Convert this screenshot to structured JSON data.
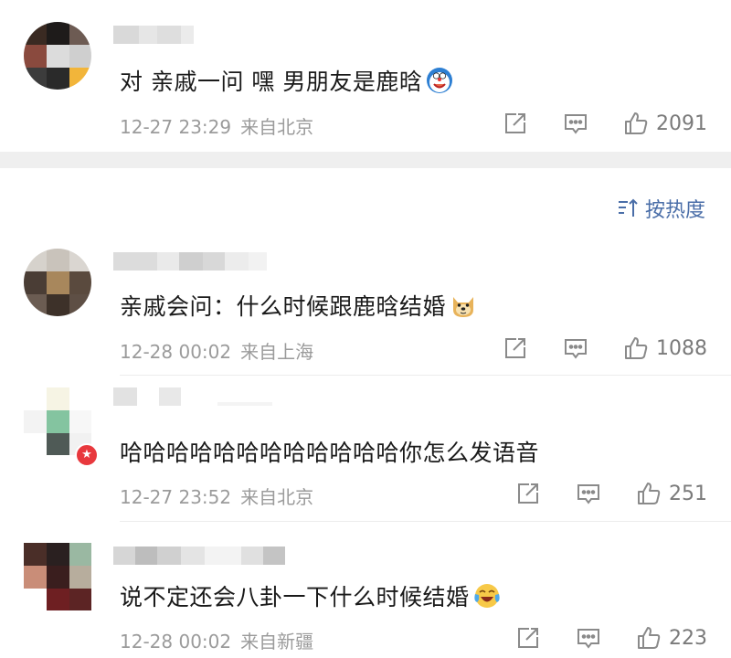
{
  "sort": {
    "label": "按热度",
    "icon": "sort-descending-icon"
  },
  "comments": [
    {
      "text": "对 亲戚一问 嘿 男朋友是鹿晗",
      "emoji": "doraemon-emoji",
      "time": "12-27 23:29",
      "location": "来自北京",
      "likes": "2091"
    },
    {
      "text": "亲戚会问：什么时候跟鹿晗结婚",
      "emoji": "doge-emoji",
      "time": "12-28 00:02",
      "location": "来自上海",
      "likes": "1088"
    },
    {
      "text": "哈哈哈哈哈哈哈哈哈哈哈哈你怎么发语音",
      "emoji": "",
      "time": "12-27 23:52",
      "location": "来自北京",
      "likes": "251"
    },
    {
      "text": "说不定还会八卦一下什么时候结婚",
      "emoji": "laugh-cry-emoji",
      "time": "12-28 00:02",
      "location": "来自新疆",
      "likes": "223"
    }
  ],
  "colors": {
    "link": "#4a6ea8",
    "meta": "#9b9b9b",
    "badge": "#e8383d"
  }
}
